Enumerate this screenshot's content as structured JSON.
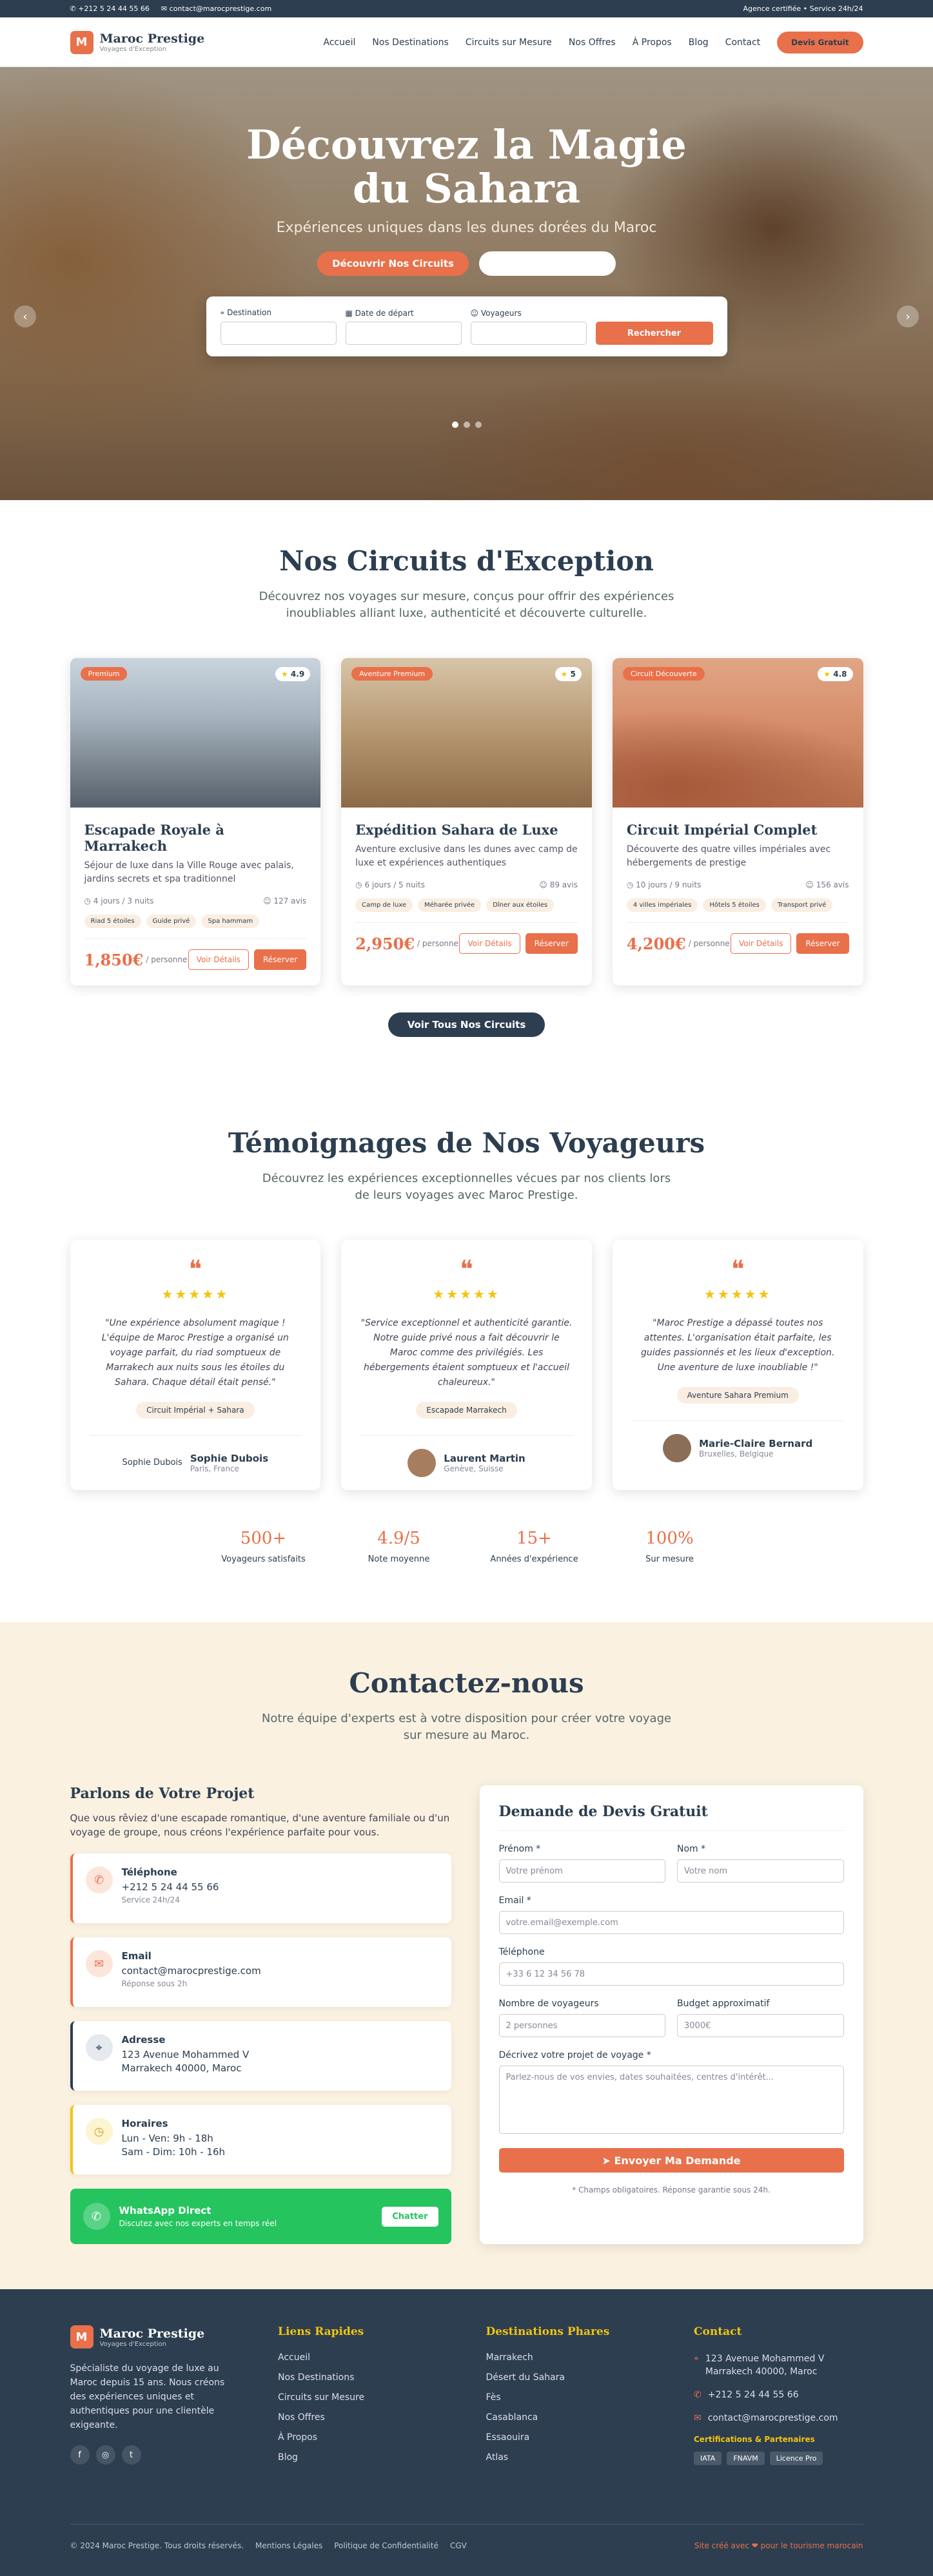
{
  "topbar": {
    "phone": "+212 5 24 44 55 66",
    "email": "contact@marocprestige.com",
    "right": "Agence certifiée • Service 24h/24"
  },
  "brand": {
    "letter": "M",
    "name": "Maroc Prestige",
    "tagline": "Voyages d'Exception"
  },
  "nav": {
    "items": [
      "Accueil",
      "Nos Destinations",
      "Circuits sur Mesure",
      "Nos Offres",
      "À Propos",
      "Blog",
      "Contact"
    ],
    "cta": "Devis Gratuit"
  },
  "hero": {
    "title": "Découvrez la Magie du Sahara",
    "subtitle": "Expériences uniques dans les dunes dorées du Maroc",
    "btn_primary": "Découvrir Nos Circuits",
    "btn_secondary": "",
    "search": {
      "destination_label": "Destination",
      "date_label": "Date de départ",
      "travelers_label": "Voyageurs",
      "submit": "Rechercher"
    }
  },
  "circuits": {
    "title": "Nos Circuits d'Exception",
    "subtitle": "Découvrez nos voyages sur mesure, conçus pour offrir des expériences inoubliables alliant luxe, authenticité et découverte culturelle.",
    "cta": "Voir Tous Nos Circuits",
    "cards": [
      {
        "badge": "Premium",
        "rating": "4.9",
        "title": "Escapade Royale à Marrakech",
        "desc": "Séjour de luxe dans la Ville Rouge avec palais, jardins secrets et spa traditionnel",
        "duration": "4 jours / 3 nuits",
        "reviews": "127 avis",
        "tags": [
          "Riad 5 étoiles",
          "Guide privé",
          "Spa hammam"
        ],
        "price": "1,850€",
        "per": "/ personne",
        "details": "Voir Détails",
        "book": "Réserver"
      },
      {
        "badge": "Aventure Premium",
        "rating": "5",
        "title": "Expédition Sahara de Luxe",
        "desc": "Aventure exclusive dans les dunes avec camp de luxe et expériences authentiques",
        "duration": "6 jours / 5 nuits",
        "reviews": "89 avis",
        "tags": [
          "Camp de luxe",
          "Méharée privée",
          "Dîner aux étoiles"
        ],
        "price": "2,950€",
        "per": "/ personne",
        "details": "Voir Détails",
        "book": "Réserver"
      },
      {
        "badge": "Circuit Découverte",
        "rating": "4.8",
        "title": "Circuit Impérial Complet",
        "desc": "Découverte des quatre villes impériales avec hébergements de prestige",
        "duration": "10 jours / 9 nuits",
        "reviews": "156 avis",
        "tags": [
          "4 villes impériales",
          "Hôtels 5 étoiles",
          "Transport privé"
        ],
        "price": "4,200€",
        "per": "/ personne",
        "details": "Voir Détails",
        "book": "Réserver"
      }
    ]
  },
  "testimonials": {
    "title": "Témoignages de Nos Voyageurs",
    "subtitle": "Découvrez les expériences exceptionnelles vécues par nos clients lors de leurs voyages avec Maroc Prestige.",
    "items": [
      {
        "quote": "\"Une expérience absolument magique ! L'équipe de Maroc Prestige a organisé un voyage parfait, du riad somptueux de Marrakech aux nuits sous les étoiles du Sahara. Chaque détail était pensé.\"",
        "tag": "Circuit Impérial + Sahara",
        "avatar_alt": "Sophie Dubois",
        "name": "Sophie Dubois",
        "city": "Paris, France"
      },
      {
        "quote": "\"Service exceptionnel et authenticité garantie. Notre guide privé nous a fait découvrir le Maroc comme des privilégiés. Les hébergements étaient somptueux et l'accueil chaleureux.\"",
        "tag": "Escapade Marrakech",
        "avatar_alt": "",
        "name": "Laurent Martin",
        "city": "Genève, Suisse"
      },
      {
        "quote": "\"Maroc Prestige a dépassé toutes nos attentes. L'organisation était parfaite, les guides passionnés et les lieux d'exception. Une aventure de luxe inoubliable !\"",
        "tag": "Aventure Sahara Premium",
        "avatar_alt": "",
        "name": "Marie-Claire Bernard",
        "city": "Bruxelles, Belgique"
      }
    ],
    "stats": [
      {
        "n": "500+",
        "l": "Voyageurs satisfaits"
      },
      {
        "n": "4.9/5",
        "l": "Note moyenne"
      },
      {
        "n": "15+",
        "l": "Années d'expérience"
      },
      {
        "n": "100%",
        "l": "Sur mesure"
      }
    ]
  },
  "contact": {
    "title": "Contactez-nous",
    "subtitle": "Notre équipe d'experts est à votre disposition pour créer votre voyage sur mesure au Maroc.",
    "left_title": "Parlons de Votre Projet",
    "intro": "Que vous rêviez d'une escapade romantique, d'une aventure familiale ou d'un voyage de groupe, nous créons l'expérience parfaite pour vous.",
    "phone": {
      "t": "Téléphone",
      "v": "+212 5 24 44 55 66",
      "s": "Service 24h/24"
    },
    "email": {
      "t": "Email",
      "v": "contact@marocprestige.com",
      "s": "Réponse sous 2h"
    },
    "address": {
      "t": "Adresse",
      "v1": "123 Avenue Mohammed V",
      "v2": "Marrakech 40000, Maroc"
    },
    "hours": {
      "t": "Horaires",
      "v1": "Lun - Ven: 9h - 18h",
      "v2": "Sam - Dim: 10h - 16h"
    },
    "whatsapp": {
      "t": "WhatsApp Direct",
      "s": "Discutez avec nos experts en temps réel",
      "btn": "Chatter"
    },
    "form": {
      "title": "Demande de Devis Gratuit",
      "firstname_l": "Prénom *",
      "firstname_p": "Votre prénom",
      "lastname_l": "Nom *",
      "lastname_p": "Votre nom",
      "email_l": "Email *",
      "email_p": "votre.email@exemple.com",
      "phone_l": "Téléphone",
      "phone_p": "+33 6 12 34 56 78",
      "travelers_l": "Nombre de voyageurs",
      "travelers_v": "2 personnes",
      "budget_l": "Budget approximatif",
      "budget_v": "3000€",
      "project_l": "Décrivez votre projet de voyage *",
      "project_p": "Parlez-nous de vos envies, dates souhaitées, centres d'intérêt...",
      "submit": "Envoyer Ma Demande",
      "note": "* Champs obligatoires. Réponse garantie sous 24h."
    }
  },
  "footer": {
    "desc": "Spécialiste du voyage de luxe au Maroc depuis 15 ans. Nous créons des expériences uniques et authentiques pour une clientèle exigeante.",
    "links_title": "Liens Rapides",
    "links": [
      "Accueil",
      "Nos Destinations",
      "Circuits sur Mesure",
      "Nos Offres",
      "À Propos",
      "Blog"
    ],
    "dest_title": "Destinations Phares",
    "dests": [
      "Marrakech",
      "Désert du Sahara",
      "Fès",
      "Casablanca",
      "Essaouira",
      "Atlas"
    ],
    "contact_title": "Contact",
    "address1": "123 Avenue Mohammed V",
    "address2": "Marrakech 40000, Maroc",
    "phone": "+212 5 24 44 55 66",
    "email": "contact@marocprestige.com",
    "cert_title": "Certifications & Partenaires",
    "certs": [
      "IATA",
      "FNAVM",
      "Licence Pro"
    ],
    "copyright": "© 2024 Maroc Prestige. Tous droits réservés.",
    "legal": "Mentions Légales",
    "privacy": "Politique de Confidentialité",
    "cgv": "CGV",
    "credit": "Site créé avec ❤ pour le tourisme marocain"
  }
}
